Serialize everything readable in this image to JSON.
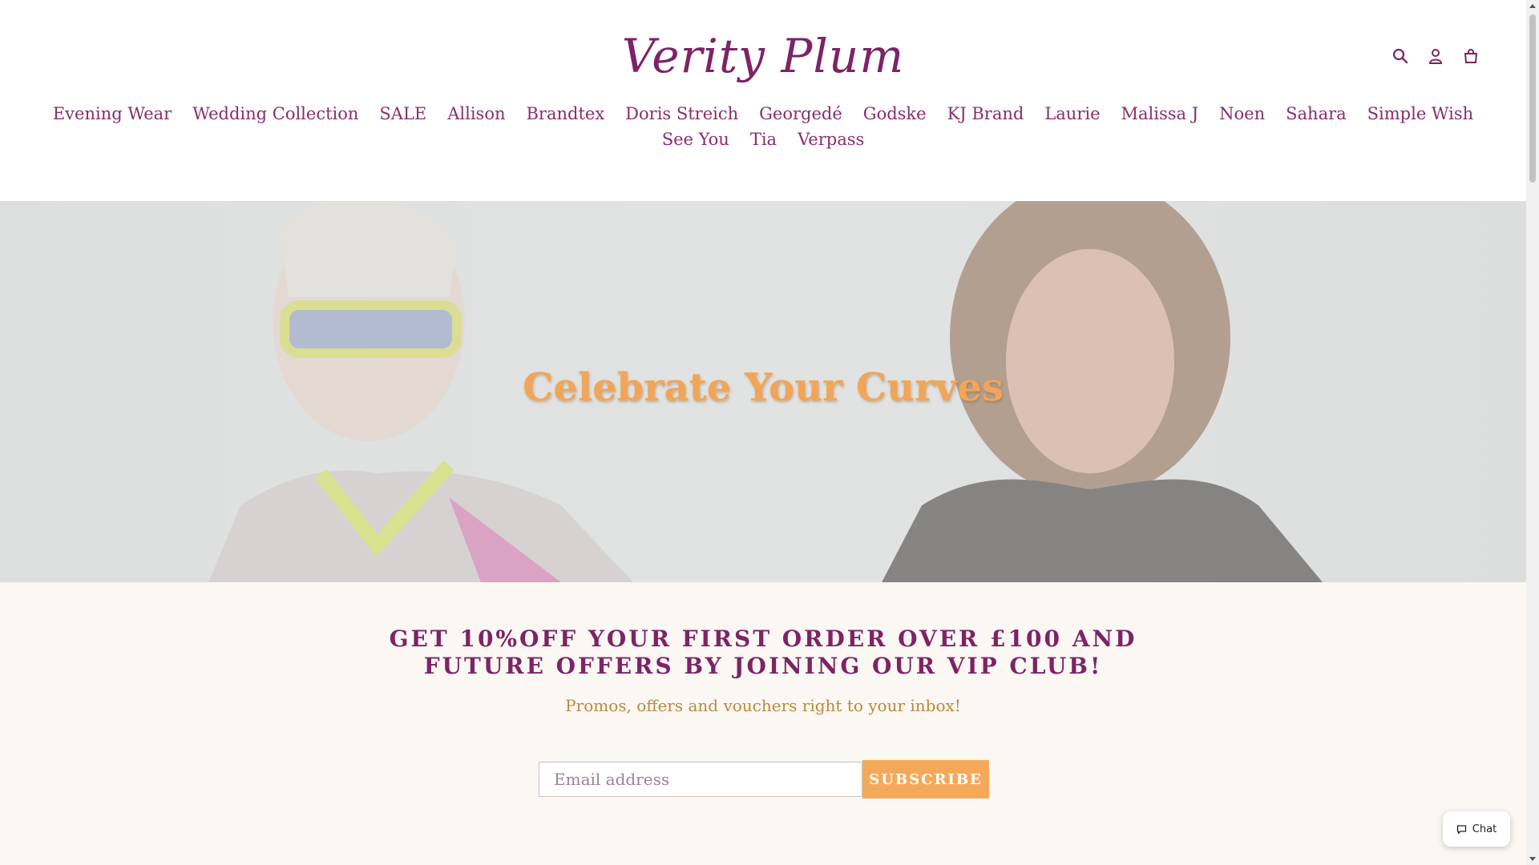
{
  "brand": {
    "logo_text": "Verity Plum"
  },
  "header": {
    "icons": [
      "search-icon",
      "account-icon",
      "cart-icon"
    ]
  },
  "nav": {
    "items": [
      "Evening Wear",
      "Wedding Collection",
      "SALE",
      "Allison",
      "Brandtex",
      "Doris Streich",
      "Georgedé",
      "Godske",
      "KJ Brand",
      "Laurie",
      "Malissa J",
      "Noen",
      "Sahara",
      "Simple Wish",
      "See You",
      "Tia",
      "Verpass"
    ]
  },
  "hero": {
    "title": "Celebrate Your Curves"
  },
  "newsletter": {
    "heading": "GET 10%OFF YOUR FIRST ORDER OVER £100 AND FUTURE OFFERS BY JOINING OUR VIP CLUB!",
    "subheading": "Promos, offers and vouchers right to your inbox!",
    "email_placeholder": "Email address",
    "button_label": "SUBSCRIBE"
  },
  "chat": {
    "label": "Chat"
  },
  "colors": {
    "brand": "#7d2366",
    "accent": "#f4a95a",
    "subtext": "#b98a3c",
    "newsletter_bg": "#fbf7f3"
  }
}
